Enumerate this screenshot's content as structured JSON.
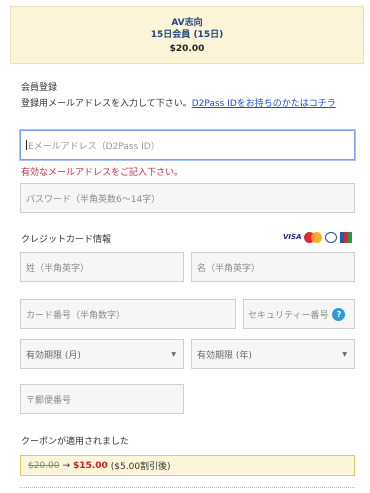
{
  "plan": {
    "name": "AV志向",
    "term": "15日会員 (15日)",
    "price": "$20.00"
  },
  "registration": {
    "section_title": "会員登録",
    "instruction": "登録用メールアドレスを入力して下さい。",
    "link_text": "D2Pass IDをお持ちのかたはコチラ",
    "email_placeholder": "Eメールアドレス（D2Pass ID）",
    "email_value": "",
    "email_error": "有効なメールアドレスをご記入下さい。",
    "password_placeholder": "パスワード（半角英数6〜14字）"
  },
  "credit_card": {
    "section_title": "クレジットカード情報",
    "brands": [
      "VISA",
      "MasterCard",
      "Diners Club",
      "JCB"
    ],
    "last_name_placeholder": "姓（半角英字）",
    "first_name_placeholder": "名（半角英字）",
    "card_number_placeholder": "カード番号（半角数字）",
    "security_code_label": "セキュリティー番号",
    "help_icon_glyph": "?",
    "expiry_month_selected": "有効期限 (月)",
    "expiry_year_selected": "有効期限 (年)",
    "postal_placeholder": "〒郵便番号"
  },
  "coupon": {
    "applied_text": "クーポンが適用されました",
    "old_price": "$20.00",
    "arrow": "→",
    "new_price": "$15.00",
    "discount_text": "($5.00割引後)"
  },
  "colors": {
    "plan_bg": "#fbf4d9",
    "plan_title": "#20467a",
    "link": "#1a4fd0",
    "error": "#c0304a",
    "new_price": "#d31b1b",
    "help_icon": "#2d9bd8"
  }
}
